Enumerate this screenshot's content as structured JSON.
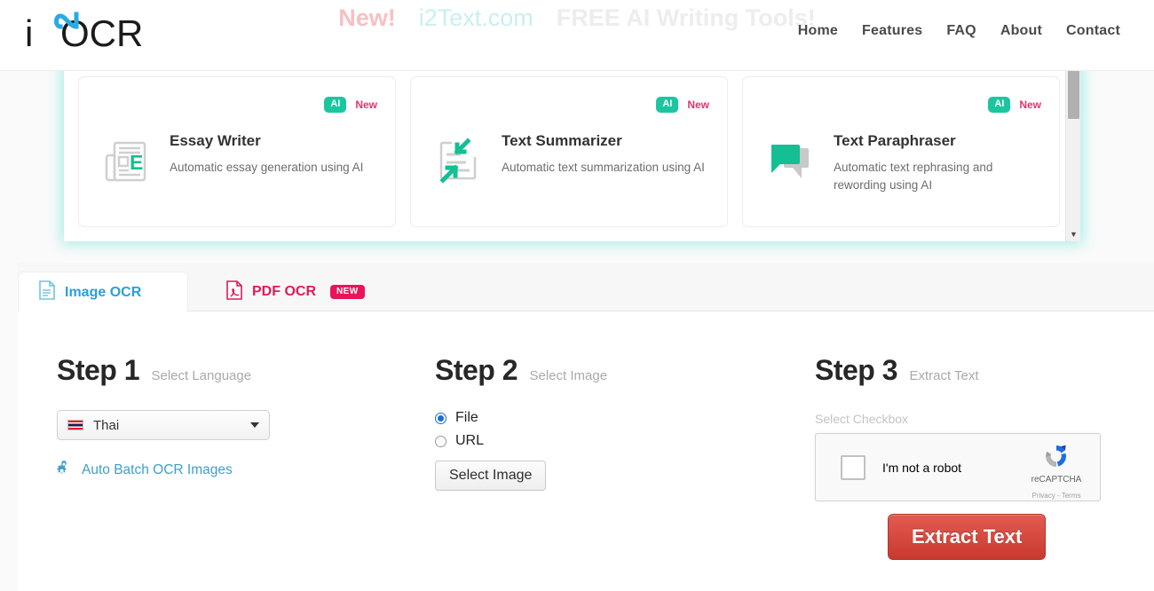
{
  "header": {
    "logo_text": "i2OCR",
    "promo": {
      "new_label": "New!",
      "site": "i2Text.com",
      "tagline": "FREE AI Writing Tools!"
    },
    "nav": [
      {
        "label": "Home"
      },
      {
        "label": "Features"
      },
      {
        "label": "FAQ"
      },
      {
        "label": "About"
      },
      {
        "label": "Contact"
      }
    ]
  },
  "ai_tools": {
    "badge_ai": "AI",
    "badge_new": "New",
    "cards": [
      {
        "title": "Essay Writer",
        "description": "Automatic essay generation using AI",
        "icon": "document-e-icon"
      },
      {
        "title": "Text Summarizer",
        "description": "Automatic text summarization using AI",
        "icon": "document-arrows-in-icon"
      },
      {
        "title": "Text Paraphraser",
        "description": "Automatic text rephrasing and rewording using AI",
        "icon": "speech-bubbles-icon"
      }
    ]
  },
  "tabs": [
    {
      "label": "Image OCR",
      "icon": "image-document-icon",
      "active": true,
      "badge": ""
    },
    {
      "label": "PDF OCR",
      "icon": "pdf-document-icon",
      "active": false,
      "badge": "NEW"
    }
  ],
  "steps": {
    "step1": {
      "number": "Step 1",
      "subtitle": "Select Language",
      "language": {
        "selected": "Thai",
        "flag": "thailand-flag-icon",
        "caret": "chevron-down-icon"
      },
      "batch_link": {
        "label": "Auto Batch OCR Images",
        "icon": "gears-icon"
      }
    },
    "step2": {
      "number": "Step 2",
      "subtitle": "Select Image",
      "options": [
        {
          "label": "File",
          "selected": true
        },
        {
          "label": "URL",
          "selected": false
        }
      ],
      "select_button": "Select Image"
    },
    "step3": {
      "number": "Step 3",
      "subtitle": "Extract Text",
      "checkbox_hint": "Select Checkbox",
      "recaptcha": {
        "label": "I'm not a robot",
        "brand": "reCAPTCHA",
        "legal": "Privacy - Terms"
      },
      "extract_button": "Extract Text"
    }
  },
  "colors": {
    "accent_teal": "#1cc5a0",
    "accent_pink": "#e8316c",
    "tab_blue": "#2a9fd8",
    "tab_pink": "#e01a5c",
    "link_blue": "#3e9fcb",
    "button_red": "#c9392e"
  }
}
